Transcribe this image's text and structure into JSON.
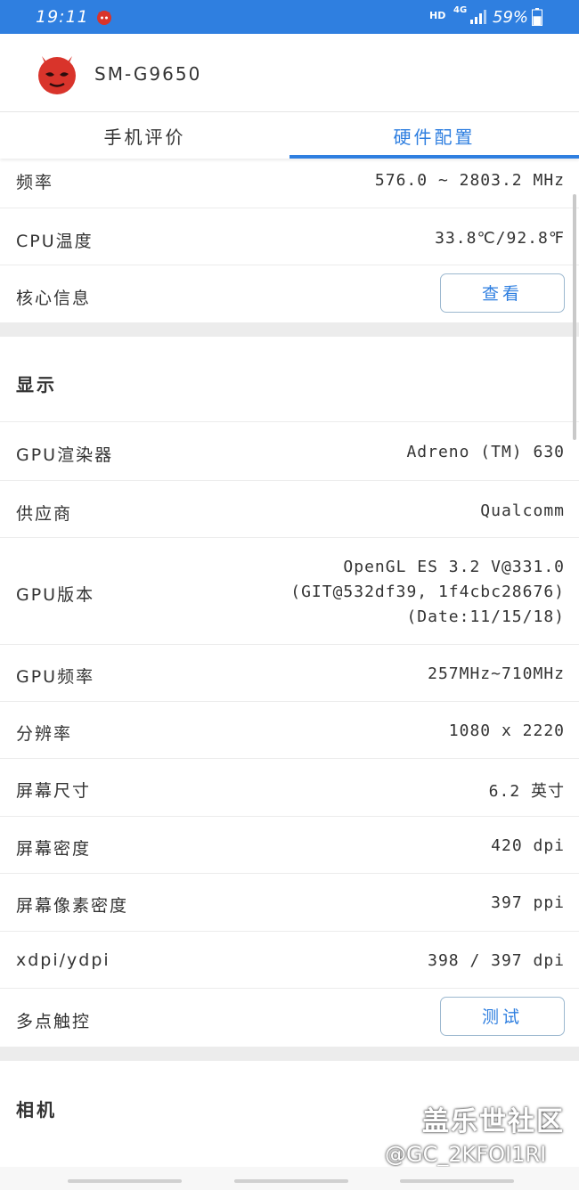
{
  "status_bar": {
    "time": "19:11",
    "network_hd": "HD",
    "network_type": "4G",
    "battery_percent": "59%",
    "battery_level": 0.59,
    "color": "#2f7fe0"
  },
  "header": {
    "device_model": "SM-G9650"
  },
  "tabs": [
    {
      "label": "手机评价",
      "active": false
    },
    {
      "label": "硬件配置",
      "active": true
    }
  ],
  "cpu": {
    "rows": [
      {
        "label": "频率",
        "value": "576.0 ~ 2803.2 MHz"
      },
      {
        "label": "CPU温度",
        "value": "33.8℃/92.8℉"
      }
    ],
    "core_info": {
      "label": "核心信息",
      "button": "查看"
    }
  },
  "display": {
    "title": "显示",
    "rows": [
      {
        "label": "GPU渲染器",
        "value": "Adreno (TM) 630"
      },
      {
        "label": "供应商",
        "value": "Qualcomm"
      }
    ],
    "gpu_version": {
      "label": "GPU版本",
      "lines": [
        "OpenGL ES 3.2 V@331.0",
        "(GIT@532df39, 1f4cbc28676)",
        "(Date:11/15/18)"
      ]
    },
    "rows2": [
      {
        "label": "GPU频率",
        "value": "257MHz~710MHz"
      },
      {
        "label": "分辨率",
        "value": "1080 x 2220"
      },
      {
        "label": "屏幕尺寸",
        "value": "6.2 英寸"
      },
      {
        "label": "屏幕密度",
        "value": "420 dpi"
      },
      {
        "label": "屏幕像素密度",
        "value": "397 ppi"
      },
      {
        "label": "xdpi/ydpi",
        "value": "398 / 397 dpi"
      }
    ],
    "multitouch": {
      "label": "多点触控",
      "button": "测试"
    }
  },
  "camera": {
    "title": "相机"
  },
  "watermark": {
    "site": "盖乐世社区",
    "user": "@GC_2KFOI1RI"
  }
}
